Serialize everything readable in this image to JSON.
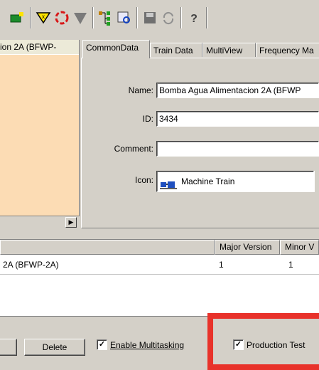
{
  "left_pane": {
    "title": "ion 2A (BFWP-"
  },
  "tabs": [
    {
      "label": "CommonData",
      "active": true
    },
    {
      "label": "Train Data",
      "active": false
    },
    {
      "label": "MultiView",
      "active": false
    },
    {
      "label": "Frequency Ma",
      "active": false
    }
  ],
  "form": {
    "name_label": "Name:",
    "name_value": "Bomba Agua Alimentacion 2A (BFWP",
    "id_label": "ID:",
    "id_value": "3434",
    "comment_label": "Comment:",
    "comment_value": "",
    "icon_label": "Icon:",
    "icon_value": "Machine Train"
  },
  "list": {
    "columns": [
      "Major Version",
      "Minor V"
    ],
    "rows": [
      {
        "name": "2A (BFWP-2A)",
        "major": "1",
        "minor": "1"
      }
    ]
  },
  "bottom": {
    "delete_label": "Delete",
    "multitasking_label": "Enable Multitasking",
    "multitasking_checked": true,
    "production_label": "Production Test",
    "production_checked": true
  },
  "colors": {
    "highlight_frame": "#e8322a",
    "left_pane_bg": "#fcdcb4"
  }
}
